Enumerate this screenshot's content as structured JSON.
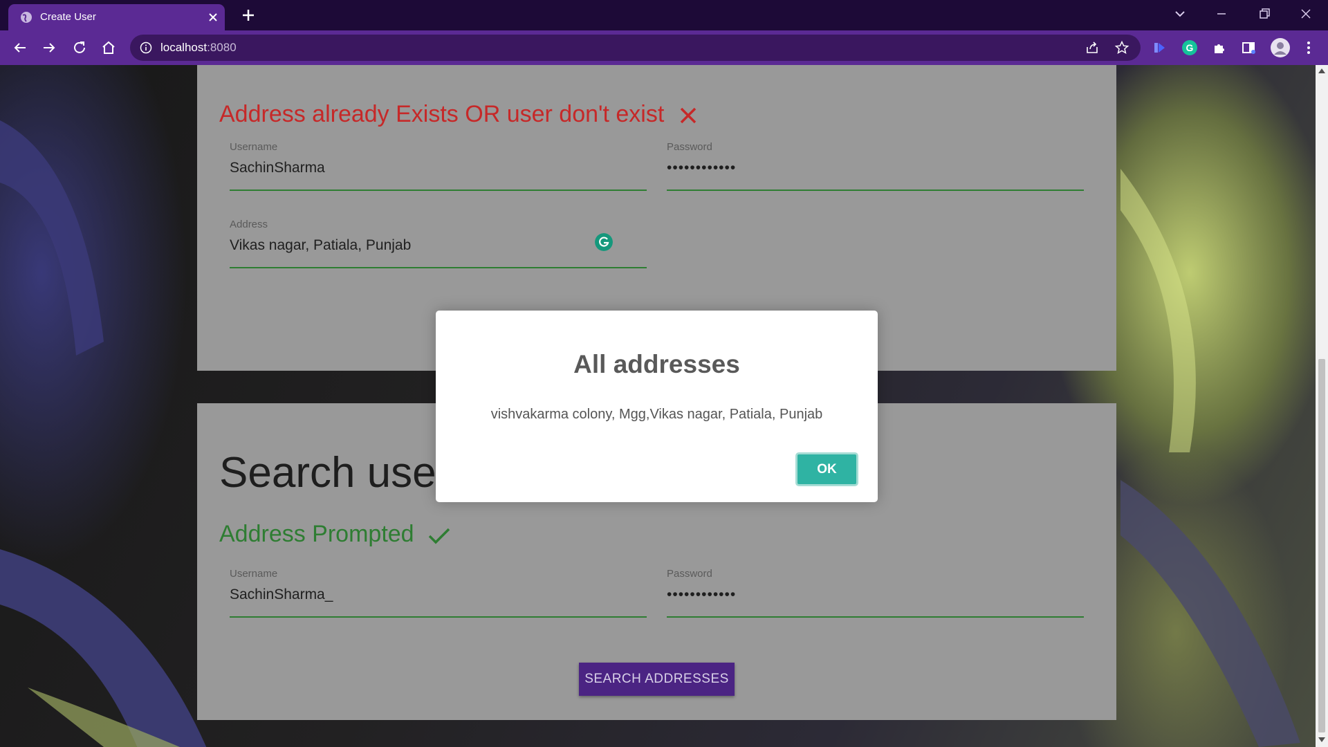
{
  "browser": {
    "tab_title": "Create User",
    "url_host": "localhost",
    "url_port": ":8080"
  },
  "page": {
    "create_card": {
      "status_message": "Address already Exists OR user don't exist",
      "status_icon": "close-icon",
      "username_label": "Username",
      "username_value": "SachinSharma",
      "password_label": "Password",
      "password_value": "••••••••••••",
      "address_label": "Address",
      "address_value": "Vikas nagar, Patiala, Punjab"
    },
    "search_card": {
      "title": "Search user",
      "status_message": "Address Prompted",
      "status_icon": "check-icon",
      "username_label": "Username",
      "username_value": "SachinSharma_",
      "password_label": "Password",
      "password_value": "••••••••••••",
      "search_button": "SEARCH ADDRESSES"
    }
  },
  "modal": {
    "title": "All addresses",
    "text": "vishvakarma colony, Mgg,Vikas nagar, Patiala, Punjab",
    "ok_button": "OK"
  },
  "colors": {
    "error": "#c62828",
    "success": "#2e7d32",
    "primary": "#4b2483",
    "modal_ok": "#2fb3a3",
    "browser_frame": "#5b2a94"
  }
}
